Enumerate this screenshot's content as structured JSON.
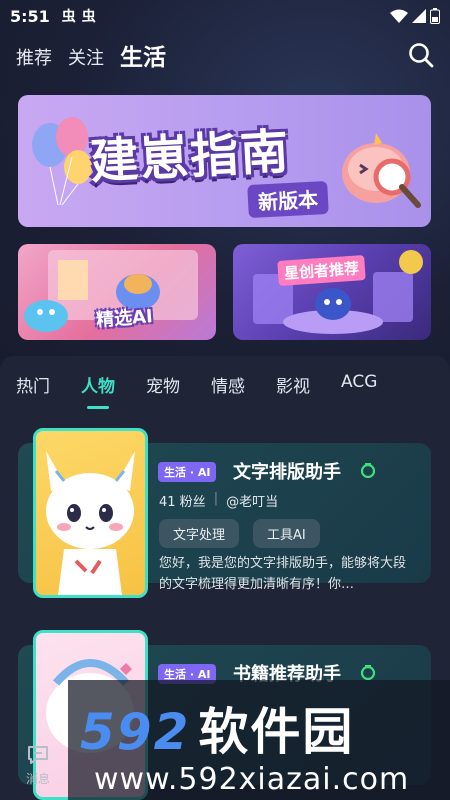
{
  "status_bar": {
    "time": "5:51",
    "notif_1": "虫",
    "notif_2": "虫"
  },
  "top_nav": {
    "tabs": [
      "推荐",
      "关注",
      "生活"
    ],
    "active_index": 2
  },
  "banner": {
    "title": "建崽指南",
    "subtitle": "新版本"
  },
  "cards": {
    "left_label": "精选AI",
    "right_label": "星创者推荐"
  },
  "categories": {
    "tabs": [
      "热门",
      "人物",
      "宠物",
      "情感",
      "影视",
      "ACG"
    ],
    "active_index": 1
  },
  "characters": [
    {
      "tag": "生活 · AI",
      "name": "文字排版助手",
      "fans": "41 粉丝",
      "author": "@老叮当",
      "chips": [
        "文字处理",
        "工具AI"
      ],
      "desc": "您好，我是您的文字排版助手，能够将大段的文字梳理得更加清晰有序！你…"
    },
    {
      "tag": "生活 · AI",
      "name": "书籍推荐助手"
    }
  ],
  "bottom_nav": {
    "messages_label": "消息"
  },
  "watermark": {
    "brand_num": "592",
    "brand_cn": "软件园",
    "url": "www.592xiazai.com"
  },
  "colors": {
    "accent": "#3ee0c7",
    "tag_purple": "#7e67f2",
    "background": "#1d2135"
  }
}
